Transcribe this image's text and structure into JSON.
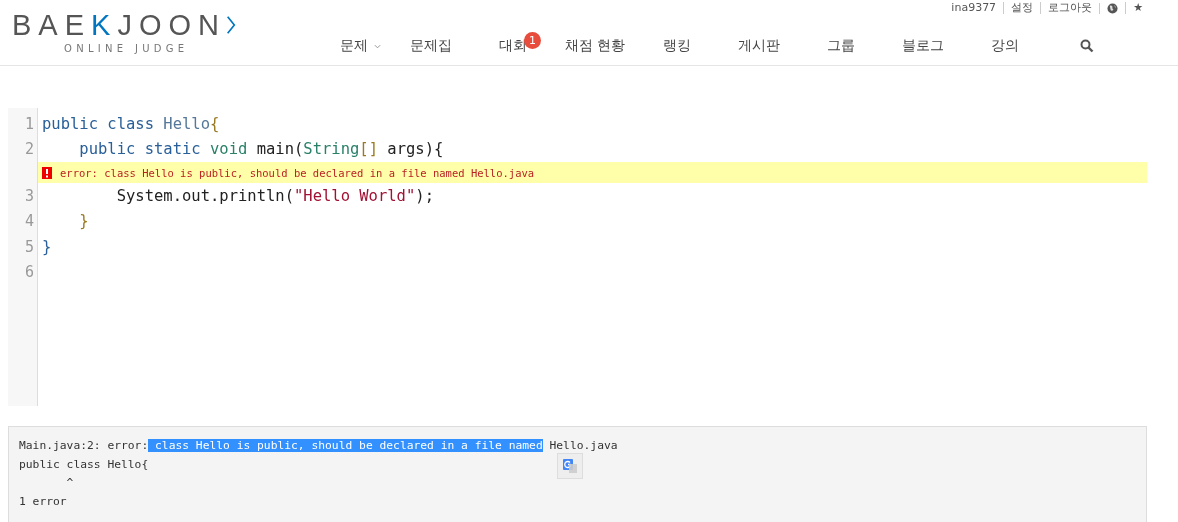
{
  "header": {
    "logo": {
      "parts": [
        {
          "text": "BAE",
          "accent": false
        },
        {
          "text": "K",
          "accent": true
        },
        {
          "text": "JOON",
          "accent": false
        }
      ],
      "subtitle": "ONLINE JUDGE"
    },
    "top_links": [
      {
        "kind": "text",
        "label": "ina9377"
      },
      {
        "kind": "text",
        "label": "설정"
      },
      {
        "kind": "text",
        "label": "로그아웃"
      },
      {
        "kind": "globe"
      },
      {
        "kind": "text",
        "label": "★"
      }
    ],
    "nav": [
      {
        "label": "문제",
        "kind": "dropdown"
      },
      {
        "label": "문제집",
        "kind": "plain"
      },
      {
        "label": "대회",
        "kind": "badge",
        "badge": "1"
      },
      {
        "label": "채점 현황",
        "kind": "plain"
      },
      {
        "label": "랭킹",
        "kind": "plain"
      },
      {
        "label": "게시판",
        "kind": "plain"
      },
      {
        "label": "그룹",
        "kind": "plain"
      },
      {
        "label": "블로그",
        "kind": "plain"
      },
      {
        "label": "강의",
        "kind": "plain"
      },
      {
        "kind": "search"
      }
    ]
  },
  "editor": {
    "lines": [
      {
        "number": "1",
        "tokens": [
          {
            "text": "public class ",
            "kind": "keyword"
          },
          {
            "text": "Hello",
            "kind": "def"
          },
          {
            "text": "{",
            "kind": "bracket"
          }
        ]
      },
      {
        "number": "2",
        "tokens": [
          {
            "text": "    public static ",
            "kind": "keyword"
          },
          {
            "text": "void",
            "kind": "type"
          },
          {
            "text": " main(",
            "kind": "plain"
          },
          {
            "text": "String",
            "kind": "type"
          },
          {
            "text": "[]",
            "kind": "bracket"
          },
          {
            "text": " args){",
            "kind": "plain"
          }
        ],
        "error": "error: class Hello is public, should be declared in a file named Hello.java"
      },
      {
        "number": "3",
        "tokens": [
          {
            "text": "        System.out.println(",
            "kind": "plain"
          },
          {
            "text": "\"Hello World\"",
            "kind": "string"
          },
          {
            "text": ");",
            "kind": "plain"
          }
        ]
      },
      {
        "number": "4",
        "tokens": [
          {
            "text": "    }",
            "kind": "bracket"
          }
        ]
      },
      {
        "number": "5",
        "tokens": [
          {
            "text": "}",
            "kind": "keyword"
          }
        ]
      },
      {
        "number": "6"
      }
    ]
  },
  "output": {
    "lines": [
      {
        "segments": [
          {
            "text": "Main.java:2: error:",
            "selected": false
          },
          {
            "text": " class Hello is public, should be declared in a file named",
            "selected": true
          },
          {
            "text": " Hello.java",
            "selected": false
          }
        ]
      },
      {
        "segments": [
          {
            "text": "public class Hello{",
            "selected": false
          }
        ]
      },
      {
        "segments": [
          {
            "text": "       ^",
            "selected": false
          }
        ]
      },
      {
        "segments": [
          {
            "text": "1 error",
            "selected": false
          }
        ]
      }
    ]
  }
}
